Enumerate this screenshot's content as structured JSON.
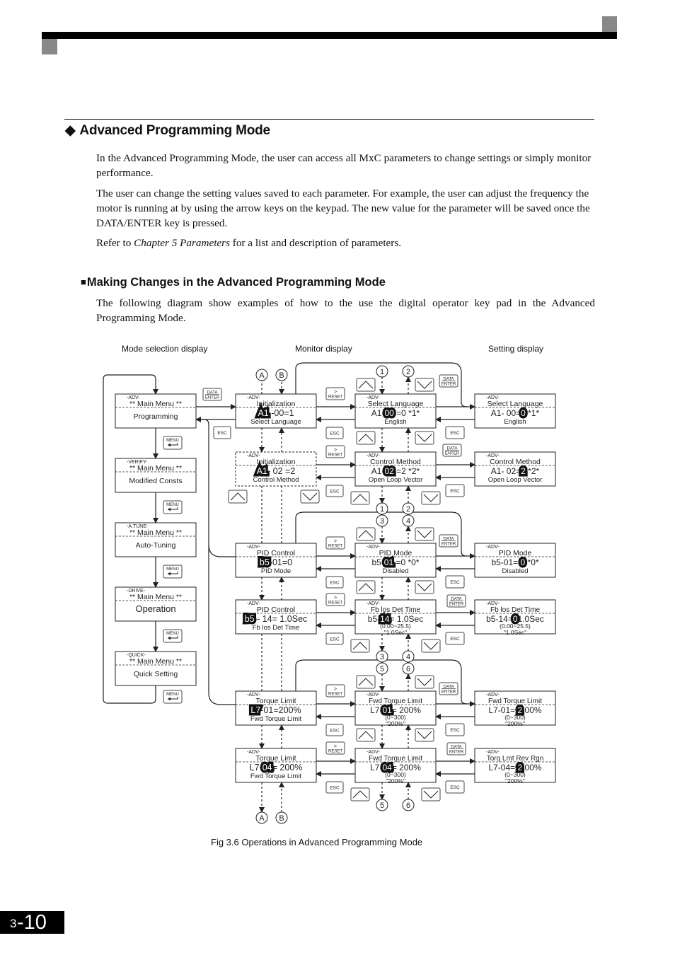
{
  "page": {
    "section_title": "Advanced Programming Mode",
    "section_marker": "◆",
    "paragraphs": [
      "In the Advanced Programming Mode, the user can access all MxC parameters to change settings or simply monitor performance.",
      "The user can change the setting values saved to each parameter. For example, the user can adjust the frequency the motor is running at by using the arrow keys on the keypad. The new value for the parameter will be saved once the DATA/ENTER key is pressed."
    ],
    "refer": {
      "prefix": "Refer to ",
      "italic": "Chapter 5 Parameters",
      "suffix": " for a list and description of parameters."
    },
    "subsection_marker": "■",
    "subsection_title": "Making Changes in the Advanced Programming Mode",
    "subsection_paragraph": "The following diagram show examples of how to the use the digital operator key pad in the Advanced Programming Mode.",
    "caption": "Fig 3.6  Operations in Advanced Programming Mode",
    "page_number_chapter": "3",
    "page_number_page": "-10"
  },
  "diagram": {
    "column_headers": [
      "Mode selection display",
      "Monitor display",
      "Setting display"
    ],
    "keys": {
      "data_enter_top": "DATA",
      "data_enter_bottom": "ENTER",
      "reset_top": ">",
      "reset_bottom": "RESET",
      "esc": "ESC",
      "menu": "MENU"
    },
    "mode_menus": [
      {
        "tag": "-ADV-",
        "title": "** Main Menu **",
        "item": "Programming"
      },
      {
        "tag": "-VERIFY-",
        "title": "** Main Menu **",
        "item": "Modified Consts"
      },
      {
        "tag": "-A.TUNE-",
        "title": "** Main Menu **",
        "item": "Auto-Tuning"
      },
      {
        "tag": "-DRIVE-",
        "title": "** Main Menu **",
        "item": "Operation"
      },
      {
        "tag": "-QUICK-",
        "title": "** Main Menu **",
        "item": "Quick Setting"
      }
    ],
    "monitor_groups": [
      {
        "tag": "-ADV-",
        "title": "Initialization",
        "hl": "A1",
        "rest": " -00=1",
        "sub": "Select Language"
      },
      {
        "tag": "-ADV-",
        "title": "Initialization",
        "hl": "A1",
        "rest": "- 02 =2",
        "sub": "Control Method"
      },
      {
        "tag": "-ADV-",
        "title": "PID Control",
        "hl": "b5",
        "rest": "-01=0",
        "sub": "PID Mode"
      },
      {
        "tag": "-ADV-",
        "title": "PID Control",
        "hl": "b5",
        "rest": " - 14= 1.0Sec",
        "sub": "Fb los Det Time"
      },
      {
        "tag": "-ADV-",
        "title": "Torque Limit",
        "hl": "L7",
        "rest": "-01=200%",
        "sub": "Fwd Torque Limit"
      },
      {
        "tag": "-ADV-",
        "title": "Torque Limit",
        "pre": "L7-",
        "hl": "04",
        "rest": "= 200%",
        "sub": "Fwd Torque Limit"
      }
    ],
    "monitor_params": [
      {
        "tag": "-ADV-",
        "title": "Select Language",
        "pre": "A1-",
        "hl": "00",
        "rest": " =0  *1*",
        "sub": "English"
      },
      {
        "tag": "-ADV-",
        "title": "Control Method",
        "pre": "A1-",
        "hl": "02",
        "rest": " =2  *2*",
        "sub": "Open Loop Vector"
      },
      {
        "tag": "-ADV-",
        "title": "PID Mode",
        "pre": "b5-",
        "hl": "01",
        "rest": " =0   *0*",
        "sub": "Disabled"
      },
      {
        "tag": "-ADV-",
        "title": "Fb los Det Time",
        "pre": "b5-",
        "hl": "14",
        "rest": "= 1.0Sec",
        "sub": "(0.00~25.5)",
        "sub2": "\"1.0Sec\""
      },
      {
        "tag": "-ADV-",
        "title": "Fwd Torque Limit",
        "pre": "L7-",
        "hl": "01",
        "rest": "= 200%",
        "sub": "(0~300)",
        "sub2": "\"200%\""
      },
      {
        "tag": "-ADV-",
        "title": "Fwd Torque Limit",
        "pre": "L7-",
        "hl": "04",
        "rest": "= 200%",
        "sub": "(0~300)",
        "sub2": "\"200%\""
      }
    ],
    "setting_params": [
      {
        "tag": "-ADV-",
        "title": "Select Language",
        "pre": "A1- 00=",
        "hl": "0",
        "rest": "  *1*",
        "sub": "English"
      },
      {
        "tag": "-ADV-",
        "title": "Control Method",
        "pre": "A1- 02=",
        "hl": "2",
        "rest": "  *2*",
        "sub": "Open Loop Vector"
      },
      {
        "tag": "-ADV-",
        "title": "PID Mode",
        "pre": "b5-01= ",
        "hl": "0",
        "rest": "  *0*",
        "sub": "Disabled"
      },
      {
        "tag": "-ADV-",
        "title": "Fb los Det Time",
        "pre": "b5-14=",
        "hl": "0",
        "rest": "1.0Sec",
        "sub": "(0.00~25.5)",
        "sub2": "\"1.0Sec\""
      },
      {
        "tag": "-ADV-",
        "title": "Fwd Torque Limit",
        "pre": "L7-01= ",
        "hl": "2",
        "rest": " 00%",
        "sub": "(0~300)",
        "sub2": "\"200%\""
      },
      {
        "tag": "-ADV-",
        "title": "Torq Lmt Rev Rgn",
        "pre": "L7-04= ",
        "hl": "2",
        "rest": " 00%",
        "sub": "(0~300)",
        "sub2": "\"200%\""
      }
    ],
    "connectors": {
      "top_left": "A",
      "top_right": "B",
      "pairs": [
        [
          "1",
          "2"
        ],
        [
          "3",
          "4"
        ],
        [
          "5",
          "6"
        ]
      ]
    }
  }
}
